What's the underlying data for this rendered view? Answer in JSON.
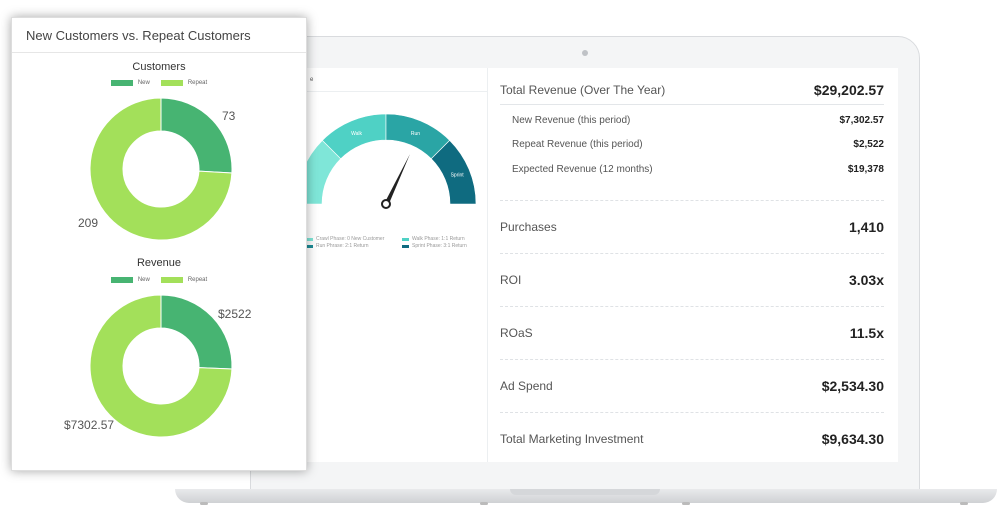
{
  "card": {
    "title": "New Customers vs. Repeat Customers",
    "colors": {
      "new": "#47b472",
      "repeat": "#a3e05a"
    },
    "charts": [
      {
        "title": "Customers",
        "legend": [
          "New",
          "Repeat"
        ],
        "labels": [
          "73",
          "209"
        ]
      },
      {
        "title": "Revenue",
        "legend": [
          "New",
          "Repeat"
        ],
        "labels": [
          "$2522",
          "$7302.57"
        ]
      }
    ]
  },
  "chart_data": [
    {
      "type": "pie",
      "title": "Customers",
      "categories": [
        "New",
        "Repeat"
      ],
      "values": [
        73,
        209
      ],
      "legend": "top-center"
    },
    {
      "type": "pie",
      "title": "Revenue",
      "categories": [
        "New",
        "Repeat"
      ],
      "values": [
        2522,
        7302.57
      ],
      "legend": "top-center"
    }
  ],
  "gauge": {
    "segment_labels": [
      "Walk",
      "Run",
      "Sprint"
    ],
    "legend": [
      {
        "text": "Crawl Phase: 0 New Customer",
        "color": "#7fe6d8"
      },
      {
        "text": "Walk Phase: 1:1 Return",
        "color": "#4fd1c5"
      },
      {
        "text": "Run Phrase: 2:1 Return",
        "color": "#1d8c96"
      },
      {
        "text": "Sprint Phase: 3:1 Return",
        "color": "#0f6b80"
      }
    ],
    "colors": [
      "#7fe6d8",
      "#4fd1c5",
      "#2aa5a5",
      "#0f6b80"
    ]
  },
  "metrics": {
    "total_revenue": {
      "label": "Total Revenue (Over The Year)",
      "value": "$29,202.57"
    },
    "new_revenue": {
      "label": "New Revenue (this period)",
      "value": "$7,302.57"
    },
    "repeat_revenue": {
      "label": "Repeat Revenue (this period)",
      "value": "$2,522"
    },
    "expected_revenue": {
      "label": "Expected Revenue (12 months)",
      "value": "$19,378"
    },
    "purchases": {
      "label": "Purchases",
      "value": "1,410"
    },
    "roi": {
      "label": "ROI",
      "value": "3.03x"
    },
    "roas": {
      "label": "ROaS",
      "value": "11.5x"
    },
    "ad_spend": {
      "label": "Ad Spend",
      "value": "$2,534.30"
    },
    "total_marketing": {
      "label": "Total Marketing Investment",
      "value": "$9,634.30"
    }
  }
}
